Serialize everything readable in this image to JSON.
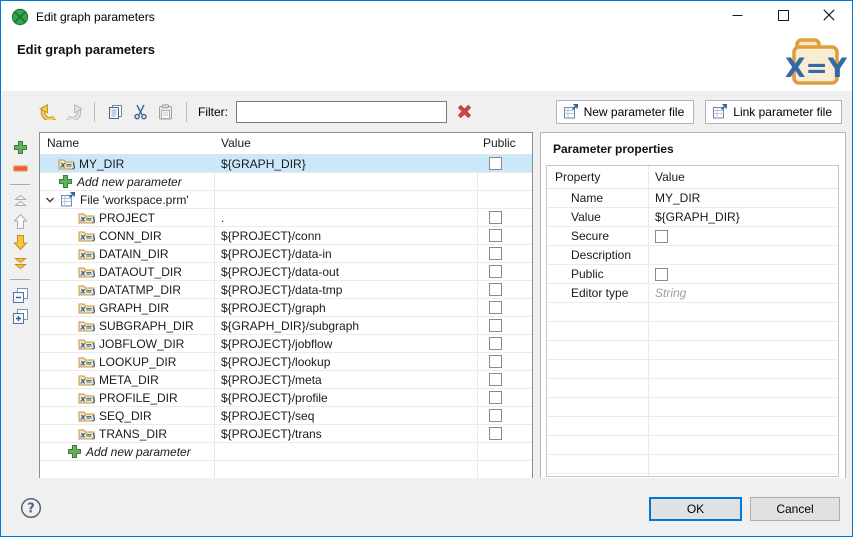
{
  "window": {
    "title": "Edit graph parameters",
    "controls": [
      "minimize-icon",
      "maximize-icon",
      "close-icon"
    ]
  },
  "header": {
    "title": "Edit graph parameters",
    "logo": "x-equals-y-folder-logo"
  },
  "colors": {
    "accent": "#0078d7",
    "selection": "#cbe8fa",
    "toolbar_bg": "#f0f0f0",
    "danger_red": "#d8453e",
    "add_green": "#62b15c",
    "gold": "#f8c73f",
    "folder_tan": "#e8b64c",
    "logo_blue": "#3568a8"
  },
  "toolbar": {
    "edit_actions": [
      {
        "name": "undo",
        "icon": "undo-icon",
        "enabled": true
      },
      {
        "name": "redo",
        "icon": "redo-icon",
        "enabled": false
      },
      {
        "separator": true
      },
      {
        "name": "copy",
        "icon": "copy-icon",
        "enabled": true
      },
      {
        "name": "cut",
        "icon": "cut-icon",
        "enabled": true
      },
      {
        "name": "paste",
        "icon": "paste-icon",
        "enabled": false
      },
      {
        "separator": true
      }
    ],
    "filter_label": "Filter:",
    "filter_value": "",
    "clear_filter_icon": "clear-filter-icon",
    "new_file_button": "New parameter file",
    "link_file_button": "Link parameter file",
    "file_button_icon": "parameter-file-icon"
  },
  "side_toolbar": [
    {
      "name": "add-parameter",
      "icon": "plus-icon",
      "enabled": true
    },
    {
      "name": "remove-parameter",
      "icon": "minus-icon",
      "enabled": true
    },
    {
      "separator": true
    },
    {
      "name": "move-to-top",
      "icon": "double-chevron-up-icon",
      "enabled": false
    },
    {
      "name": "move-up",
      "icon": "arrow-up-icon",
      "enabled": false
    },
    {
      "name": "move-down",
      "icon": "arrow-down-icon",
      "enabled": true
    },
    {
      "name": "move-to-bottom",
      "icon": "double-chevron-down-icon",
      "enabled": true
    },
    {
      "separator": true
    },
    {
      "name": "collapse-all",
      "icon": "collapse-all-icon",
      "enabled": true
    },
    {
      "name": "expand-all",
      "icon": "expand-all-icon",
      "enabled": true
    }
  ],
  "parameters_table": {
    "columns": [
      "Name",
      "Value",
      "Public"
    ],
    "rows": [
      {
        "kind": "param",
        "name": "MY_DIR",
        "value": "${GRAPH_DIR}",
        "public": false,
        "selected": true,
        "level": 1
      },
      {
        "kind": "add",
        "label": "Add new parameter",
        "level": 1
      },
      {
        "kind": "file",
        "label": "File 'workspace.prm'",
        "expanded": true
      },
      {
        "kind": "param",
        "name": "PROJECT",
        "value": ".",
        "public": false,
        "level": 2
      },
      {
        "kind": "param",
        "name": "CONN_DIR",
        "value": "${PROJECT}/conn",
        "public": false,
        "level": 2
      },
      {
        "kind": "param",
        "name": "DATAIN_DIR",
        "value": "${PROJECT}/data-in",
        "public": false,
        "level": 2
      },
      {
        "kind": "param",
        "name": "DATAOUT_DIR",
        "value": "${PROJECT}/data-out",
        "public": false,
        "level": 2
      },
      {
        "kind": "param",
        "name": "DATATMP_DIR",
        "value": "${PROJECT}/data-tmp",
        "public": false,
        "level": 2
      },
      {
        "kind": "param",
        "name": "GRAPH_DIR",
        "value": "${PROJECT}/graph",
        "public": false,
        "level": 2
      },
      {
        "kind": "param",
        "name": "SUBGRAPH_DIR",
        "value": "${GRAPH_DIR}/subgraph",
        "public": false,
        "level": 2
      },
      {
        "kind": "param",
        "name": "JOBFLOW_DIR",
        "value": "${PROJECT}/jobflow",
        "public": false,
        "level": 2
      },
      {
        "kind": "param",
        "name": "LOOKUP_DIR",
        "value": "${PROJECT}/lookup",
        "public": false,
        "level": 2
      },
      {
        "kind": "param",
        "name": "META_DIR",
        "value": "${PROJECT}/meta",
        "public": false,
        "level": 2
      },
      {
        "kind": "param",
        "name": "PROFILE_DIR",
        "value": "${PROJECT}/profile",
        "public": false,
        "level": 2
      },
      {
        "kind": "param",
        "name": "SEQ_DIR",
        "value": "${PROJECT}/seq",
        "public": false,
        "level": 2
      },
      {
        "kind": "param",
        "name": "TRANS_DIR",
        "value": "${PROJECT}/trans",
        "public": false,
        "level": 2
      },
      {
        "kind": "add",
        "label": "Add new parameter",
        "level": 2
      }
    ]
  },
  "properties_panel": {
    "title": "Parameter properties",
    "columns": [
      "Property",
      "Value"
    ],
    "rows": [
      {
        "property": "Name",
        "kind": "text",
        "value": "MY_DIR"
      },
      {
        "property": "Value",
        "kind": "text",
        "value": "${GRAPH_DIR}"
      },
      {
        "property": "Secure",
        "kind": "checkbox",
        "checked": false
      },
      {
        "property": "Description",
        "kind": "text",
        "value": ""
      },
      {
        "property": "Public",
        "kind": "checkbox",
        "checked": false
      },
      {
        "property": "Editor type",
        "kind": "hint",
        "value": "String"
      }
    ],
    "empty_filler_rows": 9
  },
  "footer": {
    "help_icon": "help-icon",
    "ok_label": "OK",
    "cancel_label": "Cancel"
  }
}
